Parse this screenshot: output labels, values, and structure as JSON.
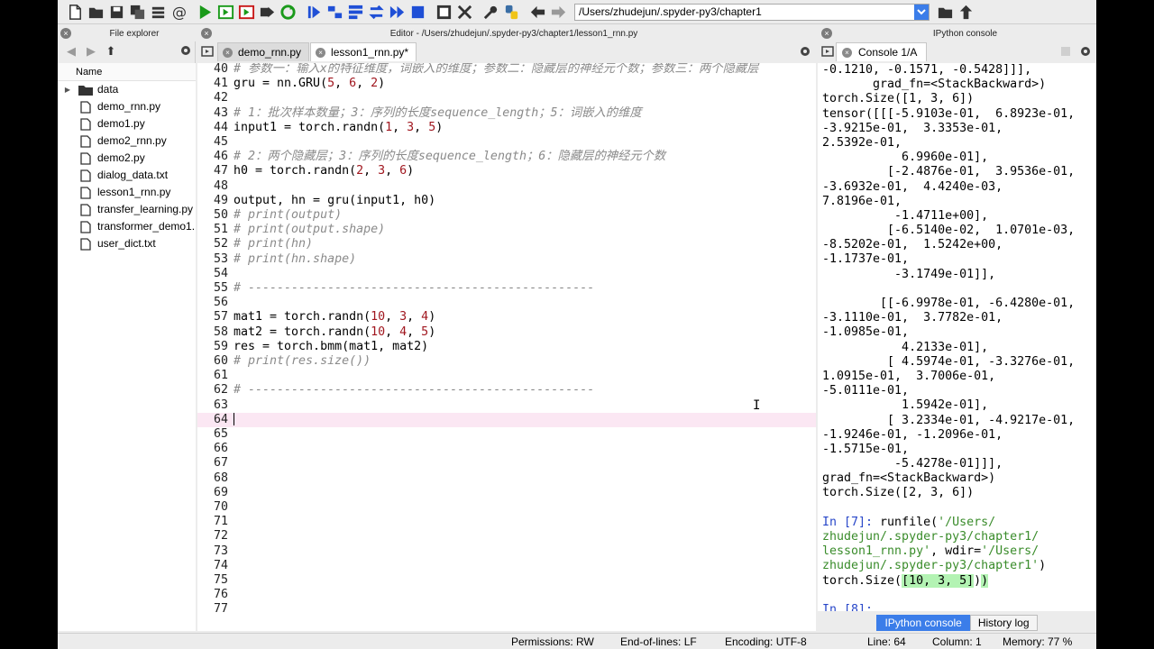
{
  "toolbar": {
    "path_value": "/Users/zhudejun/.spyder-py3/chapter1"
  },
  "file_explorer": {
    "title": "File explorer",
    "column_name": "Name",
    "items": [
      {
        "name": "data",
        "type": "folder"
      },
      {
        "name": "demo_rnn.py",
        "type": "file"
      },
      {
        "name": "demo1.py",
        "type": "file"
      },
      {
        "name": "demo2_rnn.py",
        "type": "file"
      },
      {
        "name": "demo2.py",
        "type": "file"
      },
      {
        "name": "dialog_data.txt",
        "type": "file"
      },
      {
        "name": "lesson1_rnn.py",
        "type": "file"
      },
      {
        "name": "transfer_learning.py",
        "type": "file"
      },
      {
        "name": "transformer_demo1.",
        "type": "file"
      },
      {
        "name": "user_dict.txt",
        "type": "file"
      }
    ]
  },
  "editor": {
    "title": "Editor - /Users/zhudejun/.spyder-py3/chapter1/lesson1_rnn.py",
    "tabs": [
      {
        "label": "demo_rnn.py",
        "active": false
      },
      {
        "label": "lesson1_rnn.py*",
        "active": true
      }
    ],
    "lines": [
      {
        "n": "40",
        "t": "# 参数一：输入x的特征维度，词嵌入的维度；参数二：隐藏层的神经元个数；参数三：两个隐藏层",
        "k": "cm"
      },
      {
        "n": "41",
        "t": "gru = nn.GRU(5, 6, 2)",
        "k": "code"
      },
      {
        "n": "42",
        "t": "",
        "k": "code"
      },
      {
        "n": "43",
        "t": "# 1：批次样本数量；3：序列的长度sequence_length；5：词嵌入的维度",
        "k": "cm"
      },
      {
        "n": "44",
        "t": "input1 = torch.randn(1, 3, 5)",
        "k": "code"
      },
      {
        "n": "45",
        "t": "",
        "k": "code"
      },
      {
        "n": "46",
        "t": "# 2：两个隐藏层；3：序列的长度sequence_length；6：隐藏层的神经元个数",
        "k": "cm"
      },
      {
        "n": "47",
        "t": "h0 = torch.randn(2, 3, 6)",
        "k": "code"
      },
      {
        "n": "48",
        "t": "",
        "k": "code"
      },
      {
        "n": "49",
        "t": "output, hn = gru(input1, h0)",
        "k": "code"
      },
      {
        "n": "50",
        "t": "# print(output)",
        "k": "cm"
      },
      {
        "n": "51",
        "t": "# print(output.shape)",
        "k": "cm"
      },
      {
        "n": "52",
        "t": "# print(hn)",
        "k": "cm"
      },
      {
        "n": "53",
        "t": "# print(hn.shape)",
        "k": "cm"
      },
      {
        "n": "54",
        "t": "",
        "k": "code"
      },
      {
        "n": "55",
        "t": "# ------------------------------------------------",
        "k": "cm"
      },
      {
        "n": "56",
        "t": "",
        "k": "code"
      },
      {
        "n": "57",
        "t": "mat1 = torch.randn(10, 3, 4)",
        "k": "code"
      },
      {
        "n": "58",
        "t": "mat2 = torch.randn(10, 4, 5)",
        "k": "code"
      },
      {
        "n": "59",
        "t": "res = torch.bmm(mat1, mat2)",
        "k": "code"
      },
      {
        "n": "60",
        "t": "# print(res.size())",
        "k": "cm"
      },
      {
        "n": "61",
        "t": "",
        "k": "code"
      },
      {
        "n": "62",
        "t": "# ------------------------------------------------",
        "k": "cm"
      },
      {
        "n": "63",
        "t": "",
        "k": "code"
      },
      {
        "n": "64",
        "t": "",
        "k": "current"
      },
      {
        "n": "65",
        "t": "",
        "k": "code"
      },
      {
        "n": "66",
        "t": "",
        "k": "code"
      },
      {
        "n": "67",
        "t": "",
        "k": "code"
      },
      {
        "n": "68",
        "t": "",
        "k": "code"
      },
      {
        "n": "69",
        "t": "",
        "k": "code"
      },
      {
        "n": "70",
        "t": "",
        "k": "code"
      },
      {
        "n": "71",
        "t": "",
        "k": "code"
      },
      {
        "n": "72",
        "t": "",
        "k": "code"
      },
      {
        "n": "73",
        "t": "",
        "k": "code"
      },
      {
        "n": "74",
        "t": "",
        "k": "code"
      },
      {
        "n": "75",
        "t": "",
        "k": "code"
      },
      {
        "n": "76",
        "t": "",
        "k": "code"
      },
      {
        "n": "77",
        "t": "",
        "k": "code"
      }
    ]
  },
  "console": {
    "title": "IPython console",
    "tab_label": "Console 1/A",
    "lines": [
      {
        "t": "-0.1210, -0.1571, -0.5428]]],",
        "k": "out"
      },
      {
        "t": "       grad_fn=<StackBackward>)",
        "k": "out"
      },
      {
        "t": "torch.Size([1, 3, 6])",
        "k": "out"
      },
      {
        "t": "tensor([[[-5.9103e-01,  6.8923e-01,",
        "k": "out"
      },
      {
        "t": "-3.9215e-01,  3.3353e-01,",
        "k": "out"
      },
      {
        "t": "2.5392e-01,",
        "k": "out"
      },
      {
        "t": "           6.9960e-01],",
        "k": "out"
      },
      {
        "t": "         [-2.4876e-01,  3.9536e-01,",
        "k": "out"
      },
      {
        "t": "-3.6932e-01,  4.4240e-03,",
        "k": "out"
      },
      {
        "t": "7.8196e-01,",
        "k": "out"
      },
      {
        "t": "          -1.4711e+00],",
        "k": "out"
      },
      {
        "t": "         [-6.5140e-02,  1.0701e-03,",
        "k": "out"
      },
      {
        "t": "-8.5202e-01,  1.5242e+00,",
        "k": "out"
      },
      {
        "t": "-1.1737e-01,",
        "k": "out"
      },
      {
        "t": "          -3.1749e-01]],",
        "k": "out"
      },
      {
        "t": "",
        "k": "out"
      },
      {
        "t": "        [[-6.9978e-01, -6.4280e-01,",
        "k": "out"
      },
      {
        "t": "-3.1110e-01,  3.7782e-01,",
        "k": "out"
      },
      {
        "t": "-1.0985e-01,",
        "k": "out"
      },
      {
        "t": "           4.2133e-01],",
        "k": "out"
      },
      {
        "t": "         [ 4.5974e-01, -3.3276e-01,",
        "k": "out"
      },
      {
        "t": "1.0915e-01,  3.7006e-01,",
        "k": "out"
      },
      {
        "t": "-5.0111e-01,",
        "k": "out"
      },
      {
        "t": "           1.5942e-01],",
        "k": "out"
      },
      {
        "t": "         [ 3.2334e-01, -4.9217e-01,",
        "k": "out"
      },
      {
        "t": "-1.9246e-01, -1.2096e-01,",
        "k": "out"
      },
      {
        "t": "-1.5715e-01,",
        "k": "out"
      },
      {
        "t": "          -5.4278e-01]]],",
        "k": "out"
      },
      {
        "t": "grad_fn=<StackBackward>)",
        "k": "out"
      },
      {
        "t": "torch.Size([2, 3, 6])",
        "k": "out"
      },
      {
        "t": "",
        "k": "out"
      }
    ],
    "run_prompt": "In [7]: ",
    "run_call": "runfile(",
    "run_arg1_a": "'/Users/",
    "run_arg1_b": "zhudejun/.spyder-py3/chapter1/",
    "run_arg1_c": "lesson1_rnn.py'",
    "run_wdir": ", wdir=",
    "run_arg2_a": "'/Users/",
    "run_arg2_b": "zhudejun/.spyder-py3/chapter1'",
    "run_close": ")",
    "result_pre": "torch.Size(",
    "result_hl": "[10, 3, 5]",
    "result_post": ")",
    "hl_close": ")",
    "next_prompt": "In [8]:",
    "bottom_tabs": [
      {
        "label": "IPython console",
        "active": true
      },
      {
        "label": "History log",
        "active": false
      }
    ]
  },
  "status": {
    "permissions": "Permissions:  RW",
    "eol": "End-of-lines:  LF",
    "encoding": "Encoding:  UTF-8",
    "line": "Line:  64",
    "column": "Column:  1",
    "memory": "Memory:  77 %"
  },
  "colors": {
    "accent": "#3b7de9",
    "current_line": "#fbe7f3",
    "comment": "#8a8a8a",
    "number": "#a0161e",
    "prompt": "#2847c9",
    "string": "#3a8c2b"
  }
}
